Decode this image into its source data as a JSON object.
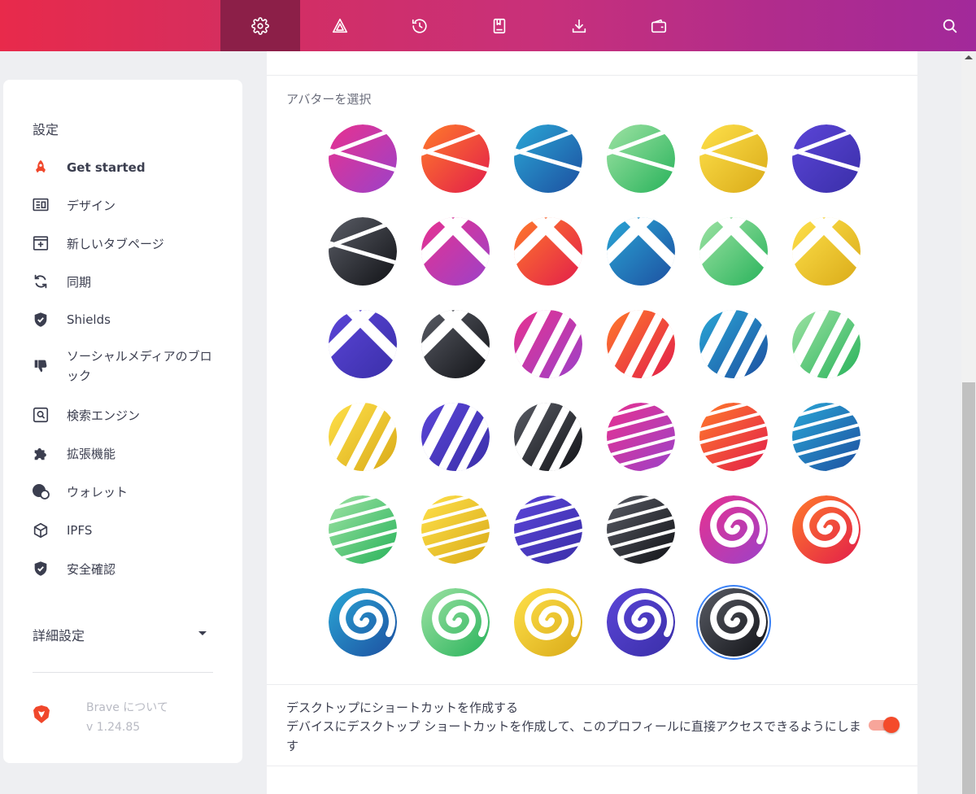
{
  "toolbar": {
    "buttons": [
      {
        "icon": "gear-icon",
        "active": true
      },
      {
        "icon": "brave-rewards-icon",
        "active": false
      },
      {
        "icon": "history-icon",
        "active": false
      },
      {
        "icon": "bookmarks-icon",
        "active": false
      },
      {
        "icon": "downloads-icon",
        "active": false
      },
      {
        "icon": "wallet-icon",
        "active": false
      }
    ],
    "search_icon": "search-icon"
  },
  "sidebar": {
    "title": "設定",
    "items": [
      {
        "label": "Get started",
        "icon": "rocket-icon",
        "active": true
      },
      {
        "label": "デザイン",
        "icon": "appearance-icon"
      },
      {
        "label": "新しいタブページ",
        "icon": "new-tab-icon"
      },
      {
        "label": "同期",
        "icon": "sync-icon"
      },
      {
        "label": "Shields",
        "icon": "shield-icon"
      },
      {
        "label": "ソーシャルメディアのブロック",
        "icon": "thumbs-down-icon"
      },
      {
        "label": "検索エンジン",
        "icon": "search-engine-icon"
      },
      {
        "label": "拡張機能",
        "icon": "puzzle-icon"
      },
      {
        "label": "ウォレット",
        "icon": "wallet-icon"
      },
      {
        "label": "IPFS",
        "icon": "cube-icon"
      },
      {
        "label": "安全確認",
        "icon": "shield-check-icon"
      }
    ],
    "advanced": "詳細設定",
    "about_title": "Brave について",
    "about_version": "v 1.24.85"
  },
  "main": {
    "avatar_heading": "アバターを選択",
    "avatars": [
      {
        "pattern": "lines",
        "c1": "#e8318f",
        "c2": "#9b42c9"
      },
      {
        "pattern": "lines",
        "c1": "#ff7b2a",
        "c2": "#e21d4b"
      },
      {
        "pattern": "lines",
        "c1": "#2aa7d6",
        "c2": "#1d4fa0"
      },
      {
        "pattern": "lines",
        "c1": "#9fe3a4",
        "c2": "#27b25a"
      },
      {
        "pattern": "lines",
        "c1": "#ffe14b",
        "c2": "#d9aa18"
      },
      {
        "pattern": "lines",
        "c1": "#5b45d8",
        "c2": "#3a2fa8"
      },
      {
        "pattern": "lines",
        "c1": "#5a5d66",
        "c2": "#111216"
      },
      {
        "pattern": "cross",
        "c1": "#e8318f",
        "c2": "#9b42c9"
      },
      {
        "pattern": "cross",
        "c1": "#ff7b2a",
        "c2": "#e21d4b"
      },
      {
        "pattern": "cross",
        "c1": "#2aa7d6",
        "c2": "#1d4fa0"
      },
      {
        "pattern": "cross",
        "c1": "#9fe3a4",
        "c2": "#27b25a"
      },
      {
        "pattern": "cross",
        "c1": "#ffe14b",
        "c2": "#d9aa18"
      },
      {
        "pattern": "cross",
        "c1": "#5b45d8",
        "c2": "#3a2fa8"
      },
      {
        "pattern": "cross",
        "c1": "#5a5d66",
        "c2": "#111216"
      },
      {
        "pattern": "stripes2",
        "c1": "#e8318f",
        "c2": "#9b42c9"
      },
      {
        "pattern": "stripes2",
        "c1": "#ff7b2a",
        "c2": "#e21d4b"
      },
      {
        "pattern": "stripes2",
        "c1": "#2aa7d6",
        "c2": "#1d4fa0"
      },
      {
        "pattern": "stripes2",
        "c1": "#9fe3a4",
        "c2": "#27b25a"
      },
      {
        "pattern": "stripes2",
        "c1": "#ffe14b",
        "c2": "#d9aa18"
      },
      {
        "pattern": "stripes2",
        "c1": "#5b45d8",
        "c2": "#3a2fa8"
      },
      {
        "pattern": "stripes2",
        "c1": "#5a5d66",
        "c2": "#111216"
      },
      {
        "pattern": "stripes",
        "c1": "#e8318f",
        "c2": "#9b42c9"
      },
      {
        "pattern": "stripes",
        "c1": "#ff7b2a",
        "c2": "#e21d4b"
      },
      {
        "pattern": "stripes",
        "c1": "#2aa7d6",
        "c2": "#1d4fa0"
      },
      {
        "pattern": "stripes",
        "c1": "#9fe3a4",
        "c2": "#27b25a"
      },
      {
        "pattern": "stripes",
        "c1": "#ffe14b",
        "c2": "#d9aa18"
      },
      {
        "pattern": "stripes",
        "c1": "#5b45d8",
        "c2": "#3a2fa8"
      },
      {
        "pattern": "stripes",
        "c1": "#5a5d66",
        "c2": "#111216"
      },
      {
        "pattern": "spiral",
        "c1": "#e8318f",
        "c2": "#9b42c9"
      },
      {
        "pattern": "spiral",
        "c1": "#ff7b2a",
        "c2": "#e21d4b"
      },
      {
        "pattern": "spiral",
        "c1": "#2aa7d6",
        "c2": "#1d4fa0"
      },
      {
        "pattern": "spiral",
        "c1": "#9fe3a4",
        "c2": "#27b25a"
      },
      {
        "pattern": "spiral",
        "c1": "#ffe14b",
        "c2": "#d9aa18"
      },
      {
        "pattern": "spiral",
        "c1": "#5b45d8",
        "c2": "#3a2fa8"
      },
      {
        "pattern": "spiral",
        "c1": "#5a5d66",
        "c2": "#111216",
        "selected": true
      }
    ],
    "shortcut_title": "デスクトップにショートカットを作成する",
    "shortcut_desc": "デバイスにデスクトップ ショートカットを作成して、このプロフィールに直接アクセスできるようにします",
    "shortcut_enabled": true
  },
  "colors": {
    "accent": "#f44b2b",
    "selected_ring": "#3b82f6"
  }
}
